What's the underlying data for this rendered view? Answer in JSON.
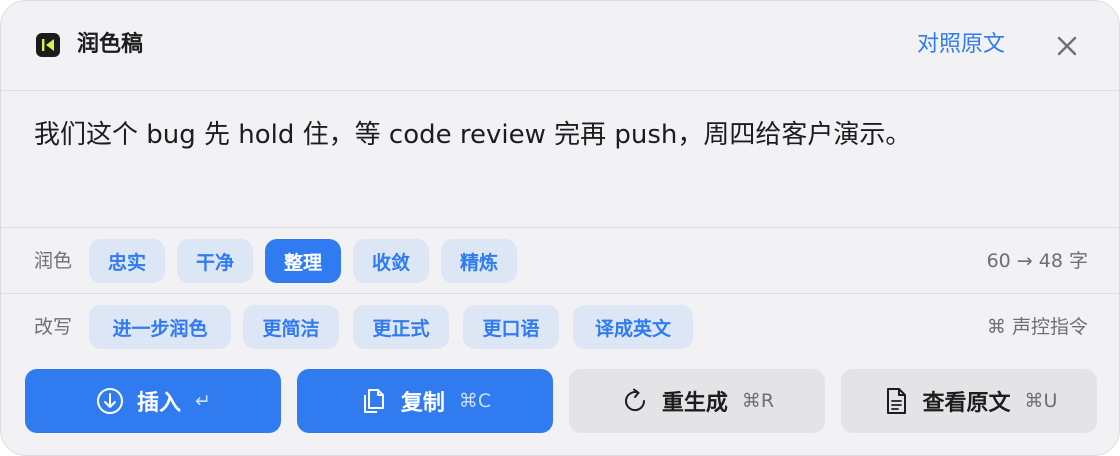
{
  "header": {
    "title": "润色稿",
    "compare_link": "对照原文"
  },
  "result": {
    "text": "我们这个 bug 先 hold 住，等 code review 完再 push，周四给客户演示。"
  },
  "polish_row": {
    "label": "润色",
    "chips": [
      "忠实",
      "干净",
      "整理",
      "收敛",
      "精炼"
    ],
    "active_chip": "整理",
    "count": "60 → 48 字"
  },
  "rewrite_row": {
    "label": "改写",
    "chips": [
      "进一步润色",
      "更简洁",
      "更正式",
      "更口语",
      "译成英文"
    ],
    "voice_hint": "⌘ 声控指令"
  },
  "actions": {
    "insert": {
      "label": "插入",
      "shortcut": "↵",
      "icon": "insert-down-icon"
    },
    "copy": {
      "label": "复制",
      "shortcut": "⌘C",
      "icon": "copy-icon"
    },
    "regenerate": {
      "label": "重生成",
      "shortcut": "⌘R",
      "icon": "refresh-icon"
    },
    "view_original": {
      "label": "查看原文",
      "shortcut": "⌘U",
      "icon": "document-icon"
    }
  },
  "colors": {
    "accent": "#2f7bef",
    "chip_bg": "#dce6f5",
    "panel_bg": "#f2f2f4",
    "logo_bg": "#1b1b1b",
    "logo_mark": "#d9f24a"
  }
}
